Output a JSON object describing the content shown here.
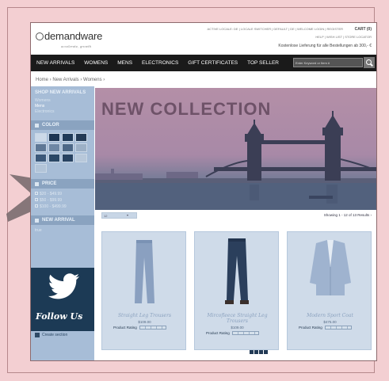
{
  "colors": {
    "page_bg": "#f3cfd2",
    "nav_bg": "#1a1a1a",
    "overlay": "#5a82b4",
    "hero": "#b48fa7",
    "twitter_bg": "#1c3a55"
  },
  "header": {
    "logo_text": "demandware",
    "tagline": "accelerate, growth",
    "utility_links": "ACTIVE LOCALE: DE | LOCALE SWITCHER | DEFAULT | DE | WELCOME LOGIN | REGISTER",
    "cart": "CART (0)",
    "help_links": "HELP | WISH LIST | STORE LOCATOR",
    "shipping_notice": "Kostenlose Lieferung für alle Bestellungen ab 300,- €"
  },
  "nav": {
    "items": [
      "NEW ARRIVALS",
      "WOMENS",
      "MENS",
      "ELECTRONICS",
      "GIFT CERTIFICATES",
      "TOP SELLER"
    ],
    "search_placeholder": "Enter Keyword or Item #"
  },
  "breadcrumb": "Home › New Arrivals › Womens ›",
  "sidebar": {
    "heading": "SHOP NEW ARRIVALS",
    "links": [
      "Womens",
      "Mens",
      "Electronics"
    ],
    "color_label": "COLOR",
    "swatch_colors": [
      "#ccd9e8",
      "#1d3552",
      "#1f3a58",
      "#233a55",
      "#5e7795",
      "#6e87a4",
      "#4d6887",
      "#9cb0c6",
      "#3b587a",
      "#2a4766",
      "#284362",
      "#b8c8da",
      "#b2c4d8"
    ],
    "price_label": "PRICE",
    "prices": [
      "$20 - $49.99",
      "$50 - $99.99",
      "$100 - $499.99"
    ],
    "new_arrival_label": "NEW ARRIVAL",
    "new_arrival_value": "true",
    "twitter_text": "Follow Us",
    "create_section": "Create section"
  },
  "hero": {
    "headline": "NEW COLLECTION"
  },
  "toolbar": {
    "page_size": "12",
    "showing": "Showing 1 - 12 of 13 Results ›"
  },
  "products": [
    {
      "name": "Straight Leg Trousers",
      "price": "$109.00",
      "rating_label": "Product Rating"
    },
    {
      "name": "Mircofleece Straight Leg Trousers",
      "price": "$109.00",
      "rating_label": "Product Rating"
    },
    {
      "name": "Modern Sport Coat",
      "price": "$475.00",
      "rating_label": "Product Rating"
    }
  ]
}
